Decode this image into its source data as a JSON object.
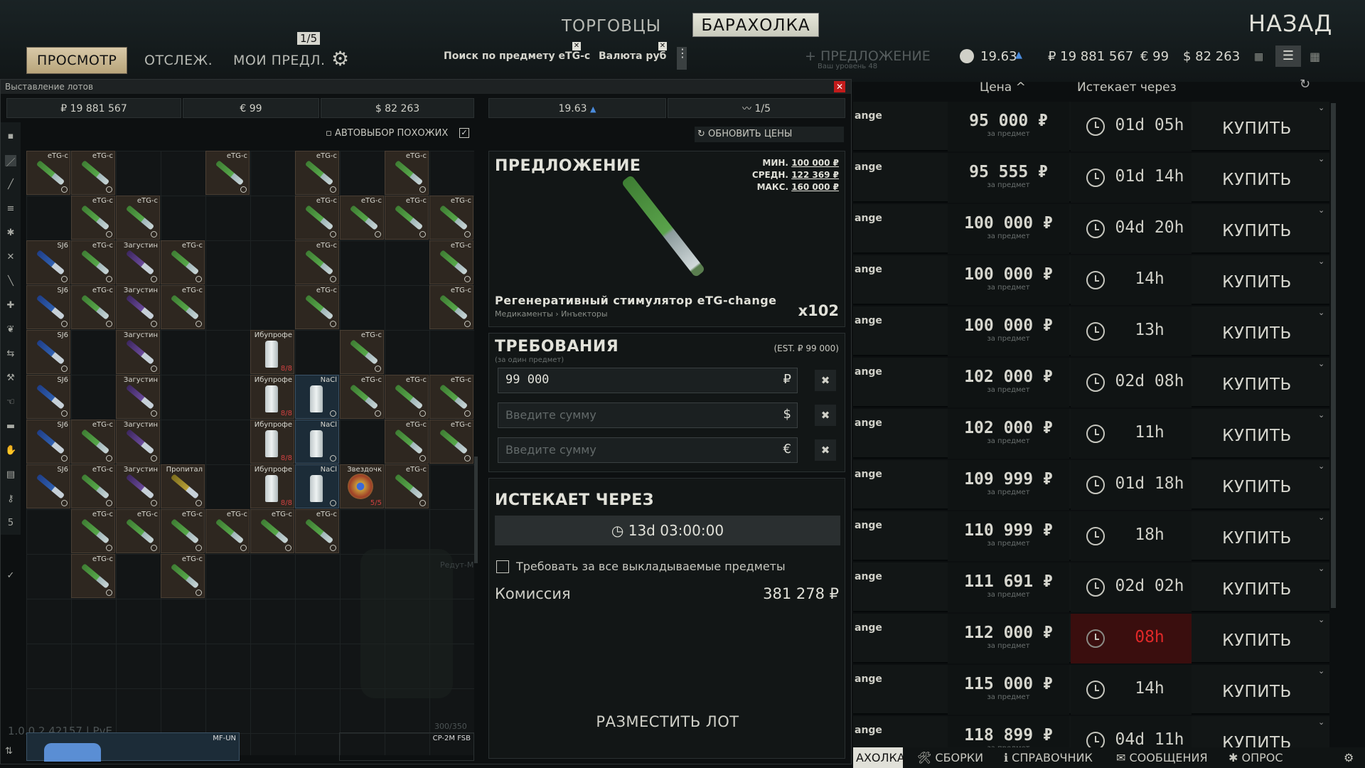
{
  "top_tabs": {
    "traders": "ТОРГОВЦЫ",
    "flea": "БАРАХОЛКА",
    "back": "НАЗАД"
  },
  "sub_tabs": {
    "browse": "ПРОСМОТР",
    "track": "ОТСЛЕЖ.",
    "my_offers": "МОИ ПРЕДЛ.",
    "offers_count": "1/5"
  },
  "filters": {
    "item_search": "Поиск по предмету eTG-c",
    "currency": "Валюта руб"
  },
  "header": {
    "add_offer": "+ ПРЕДЛОЖЕНИЕ",
    "add_offer_sub": "Ваш уровень 48",
    "rating": "19.63",
    "rub": "₽ 19 881 567",
    "eur": "€ 99",
    "usd": "$ 82 263"
  },
  "columns": {
    "price": "Цена ^",
    "expires": "Истекает через"
  },
  "listings": [
    {
      "name": "ange",
      "price": "95 000 ₽",
      "unit": "за предмет",
      "time": "01d 05h",
      "buy": "КУПИТЬ",
      "warn": false
    },
    {
      "name": "ange",
      "price": "95 555 ₽",
      "unit": "за предмет",
      "time": "01d 14h",
      "buy": "КУПИТЬ",
      "warn": false
    },
    {
      "name": "ange",
      "price": "100 000 ₽",
      "unit": "за предмет",
      "time": "04d 20h",
      "buy": "КУПИТЬ",
      "warn": false
    },
    {
      "name": "ange",
      "price": "100 000 ₽",
      "unit": "за предмет",
      "time": "14h",
      "buy": "КУПИТЬ",
      "warn": false
    },
    {
      "name": "ange",
      "price": "100 000 ₽",
      "unit": "за предмет",
      "time": "13h",
      "buy": "КУПИТЬ",
      "warn": false
    },
    {
      "name": "ange",
      "price": "102 000 ₽",
      "unit": "за предмет",
      "time": "02d 08h",
      "buy": "КУПИТЬ",
      "warn": false
    },
    {
      "name": "ange",
      "price": "102 000 ₽",
      "unit": "за предмет",
      "time": "11h",
      "buy": "КУПИТЬ",
      "warn": false
    },
    {
      "name": "ange",
      "price": "109 999 ₽",
      "unit": "за предмет",
      "time": "01d 18h",
      "buy": "КУПИТЬ",
      "warn": false
    },
    {
      "name": "ange",
      "price": "110 999 ₽",
      "unit": "за предмет",
      "time": "18h",
      "buy": "КУПИТЬ",
      "warn": false
    },
    {
      "name": "ange",
      "price": "111 691 ₽",
      "unit": "за предмет",
      "time": "02d 02h",
      "buy": "КУПИТЬ",
      "warn": false
    },
    {
      "name": "ange",
      "price": "112 000 ₽",
      "unit": "за предмет",
      "time": "08h",
      "buy": "КУПИТЬ",
      "warn": true
    },
    {
      "name": "ange",
      "price": "115 000 ₽",
      "unit": "за предмет",
      "time": "14h",
      "buy": "КУПИТЬ",
      "warn": false
    },
    {
      "name": "ange",
      "price": "118 899 ₽",
      "unit": "за предмет",
      "time": "04d 11h",
      "buy": "КУПИТЬ",
      "warn": false
    }
  ],
  "window": {
    "title": "Выставление лотов",
    "bal_rub": "₽ 19 881 567",
    "bal_eur": "€ 99",
    "bal_usd": "$ 82 263",
    "rating": "19.63",
    "offers": "1/5",
    "auto_select": "АВТОВЫБОР ПОХОЖИХ",
    "refresh": "ОБНОВИТЬ ЦЕНЫ",
    "version": "1.0.0.2.42157 | PvE",
    "capacity": "300/350",
    "ghost_label": "Редут-М",
    "bottom_items": [
      "MF-UN",
      "CP-2M FSB"
    ]
  },
  "offer": {
    "title": "ПРЕДЛОЖЕНИЕ",
    "min_label": "МИН.",
    "min": "100 000 ₽",
    "avg_label": "СРЕДН.",
    "avg": "122 369 ₽",
    "max_label": "МАКС.",
    "max": "160 000 ₽",
    "item_name": "Регенеративный стимулятор eTG-change",
    "category": "Медикаменты › Инъекторы",
    "qty": "x102"
  },
  "requirements": {
    "title": "ТРЕБОВАНИЯ",
    "subtitle": "(за один предмет)",
    "est": "(EST. ₽ 99 000)",
    "rub_value": "99 000",
    "rub_sym": "₽",
    "usd_placeholder": "Введите сумму",
    "usd_sym": "$",
    "eur_placeholder": "Введите сумму",
    "eur_sym": "€"
  },
  "expires": {
    "title": "ИСТЕКАЕТ ЧЕРЕЗ",
    "value": "13d 03:00:00"
  },
  "require_all": "Требовать за все выкладываемые предметы",
  "commission": {
    "label": "Комиссия",
    "value": "381 278 ₽"
  },
  "place": "РАЗМЕСТИТЬ ЛОТ",
  "bottom_nav": [
    "АХОЛКА",
    "СБОРКИ",
    "СПРАВОЧНИК",
    "СООБЩЕНИЯ",
    "ОПРОС"
  ],
  "inventory": [
    {
      "c": 0,
      "r": 0,
      "l": "eTG-c",
      "k": "g"
    },
    {
      "c": 1,
      "r": 0,
      "l": "eTG-c",
      "k": "g"
    },
    {
      "c": 4,
      "r": 0,
      "l": "eTG-c",
      "k": "g"
    },
    {
      "c": 6,
      "r": 0,
      "l": "eTG-c",
      "k": "g"
    },
    {
      "c": 8,
      "r": 0,
      "l": "eTG-c",
      "k": "g"
    },
    {
      "c": 1,
      "r": 1,
      "l": "eTG-c",
      "k": "g"
    },
    {
      "c": 2,
      "r": 1,
      "l": "eTG-c",
      "k": "g"
    },
    {
      "c": 6,
      "r": 1,
      "l": "eTG-c",
      "k": "g"
    },
    {
      "c": 7,
      "r": 1,
      "l": "eTG-c",
      "k": "g"
    },
    {
      "c": 8,
      "r": 1,
      "l": "eTG-c",
      "k": "g"
    },
    {
      "c": 9,
      "r": 1,
      "l": "eTG-c",
      "k": "g"
    },
    {
      "c": 0,
      "r": 2,
      "l": "SJ6",
      "k": "b"
    },
    {
      "c": 1,
      "r": 2,
      "l": "eTG-c",
      "k": "g"
    },
    {
      "c": 2,
      "r": 2,
      "l": "Загустин",
      "k": "p"
    },
    {
      "c": 3,
      "r": 2,
      "l": "eTG-c",
      "k": "g"
    },
    {
      "c": 6,
      "r": 2,
      "l": "eTG-c",
      "k": "g"
    },
    {
      "c": 9,
      "r": 2,
      "l": "eTG-c",
      "k": "g"
    },
    {
      "c": 0,
      "r": 3,
      "l": "SJ6",
      "k": "b"
    },
    {
      "c": 1,
      "r": 3,
      "l": "eTG-c",
      "k": "g"
    },
    {
      "c": 2,
      "r": 3,
      "l": "Загустин",
      "k": "p"
    },
    {
      "c": 3,
      "r": 3,
      "l": "eTG-c",
      "k": "g"
    },
    {
      "c": 6,
      "r": 3,
      "l": "eTG-c",
      "k": "g"
    },
    {
      "c": 9,
      "r": 3,
      "l": "eTG-c",
      "k": "g"
    },
    {
      "c": 0,
      "r": 4,
      "l": "SJ6",
      "k": "b"
    },
    {
      "c": 2,
      "r": 4,
      "l": "Загустин",
      "k": "p"
    },
    {
      "c": 5,
      "r": 4,
      "l": "Ибупрофе",
      "k": "bt",
      "n": "8/8"
    },
    {
      "c": 7,
      "r": 4,
      "l": "eTG-c",
      "k": "g"
    },
    {
      "c": 0,
      "r": 5,
      "l": "SJ6",
      "k": "b"
    },
    {
      "c": 2,
      "r": 5,
      "l": "Загустин",
      "k": "p"
    },
    {
      "c": 5,
      "r": 5,
      "l": "Ибупрофе",
      "k": "bt",
      "n": "8/8"
    },
    {
      "c": 6,
      "r": 5,
      "l": "NaCl",
      "k": "na"
    },
    {
      "c": 7,
      "r": 5,
      "l": "eTG-c",
      "k": "g"
    },
    {
      "c": 8,
      "r": 5,
      "l": "eTG-c",
      "k": "g"
    },
    {
      "c": 9,
      "r": 5,
      "l": "eTG-c",
      "k": "g"
    },
    {
      "c": 0,
      "r": 6,
      "l": "SJ6",
      "k": "b"
    },
    {
      "c": 1,
      "r": 6,
      "l": "eTG-c",
      "k": "g"
    },
    {
      "c": 2,
      "r": 6,
      "l": "Загустин",
      "k": "p"
    },
    {
      "c": 5,
      "r": 6,
      "l": "Ибупрофе",
      "k": "bt",
      "n": "8/8"
    },
    {
      "c": 6,
      "r": 6,
      "l": "NaCl",
      "k": "na"
    },
    {
      "c": 8,
      "r": 6,
      "l": "eTG-c",
      "k": "g"
    },
    {
      "c": 9,
      "r": 6,
      "l": "eTG-c",
      "k": "g"
    },
    {
      "c": 0,
      "r": 7,
      "l": "SJ6",
      "k": "b"
    },
    {
      "c": 1,
      "r": 7,
      "l": "eTG-c",
      "k": "g"
    },
    {
      "c": 2,
      "r": 7,
      "l": "Загустин",
      "k": "p"
    },
    {
      "c": 3,
      "r": 7,
      "l": "Пропитал",
      "k": "y"
    },
    {
      "c": 5,
      "r": 7,
      "l": "Ибупрофе",
      "k": "bt",
      "n": "8/8"
    },
    {
      "c": 6,
      "r": 7,
      "l": "NaCl",
      "k": "na"
    },
    {
      "c": 7,
      "r": 7,
      "l": "Звездочк",
      "k": "st",
      "n": "5/5"
    },
    {
      "c": 8,
      "r": 7,
      "l": "eTG-c",
      "k": "g"
    },
    {
      "c": 1,
      "r": 8,
      "l": "eTG-c",
      "k": "g"
    },
    {
      "c": 2,
      "r": 8,
      "l": "eTG-c",
      "k": "g"
    },
    {
      "c": 3,
      "r": 8,
      "l": "eTG-c",
      "k": "g"
    },
    {
      "c": 4,
      "r": 8,
      "l": "eTG-c",
      "k": "g"
    },
    {
      "c": 5,
      "r": 8,
      "l": "eTG-c",
      "k": "g"
    },
    {
      "c": 6,
      "r": 8,
      "l": "eTG-c",
      "k": "g"
    },
    {
      "c": 1,
      "r": 9,
      "l": "eTG-c",
      "k": "g"
    },
    {
      "c": 3,
      "r": 9,
      "l": "eTG-c",
      "k": "g"
    }
  ]
}
